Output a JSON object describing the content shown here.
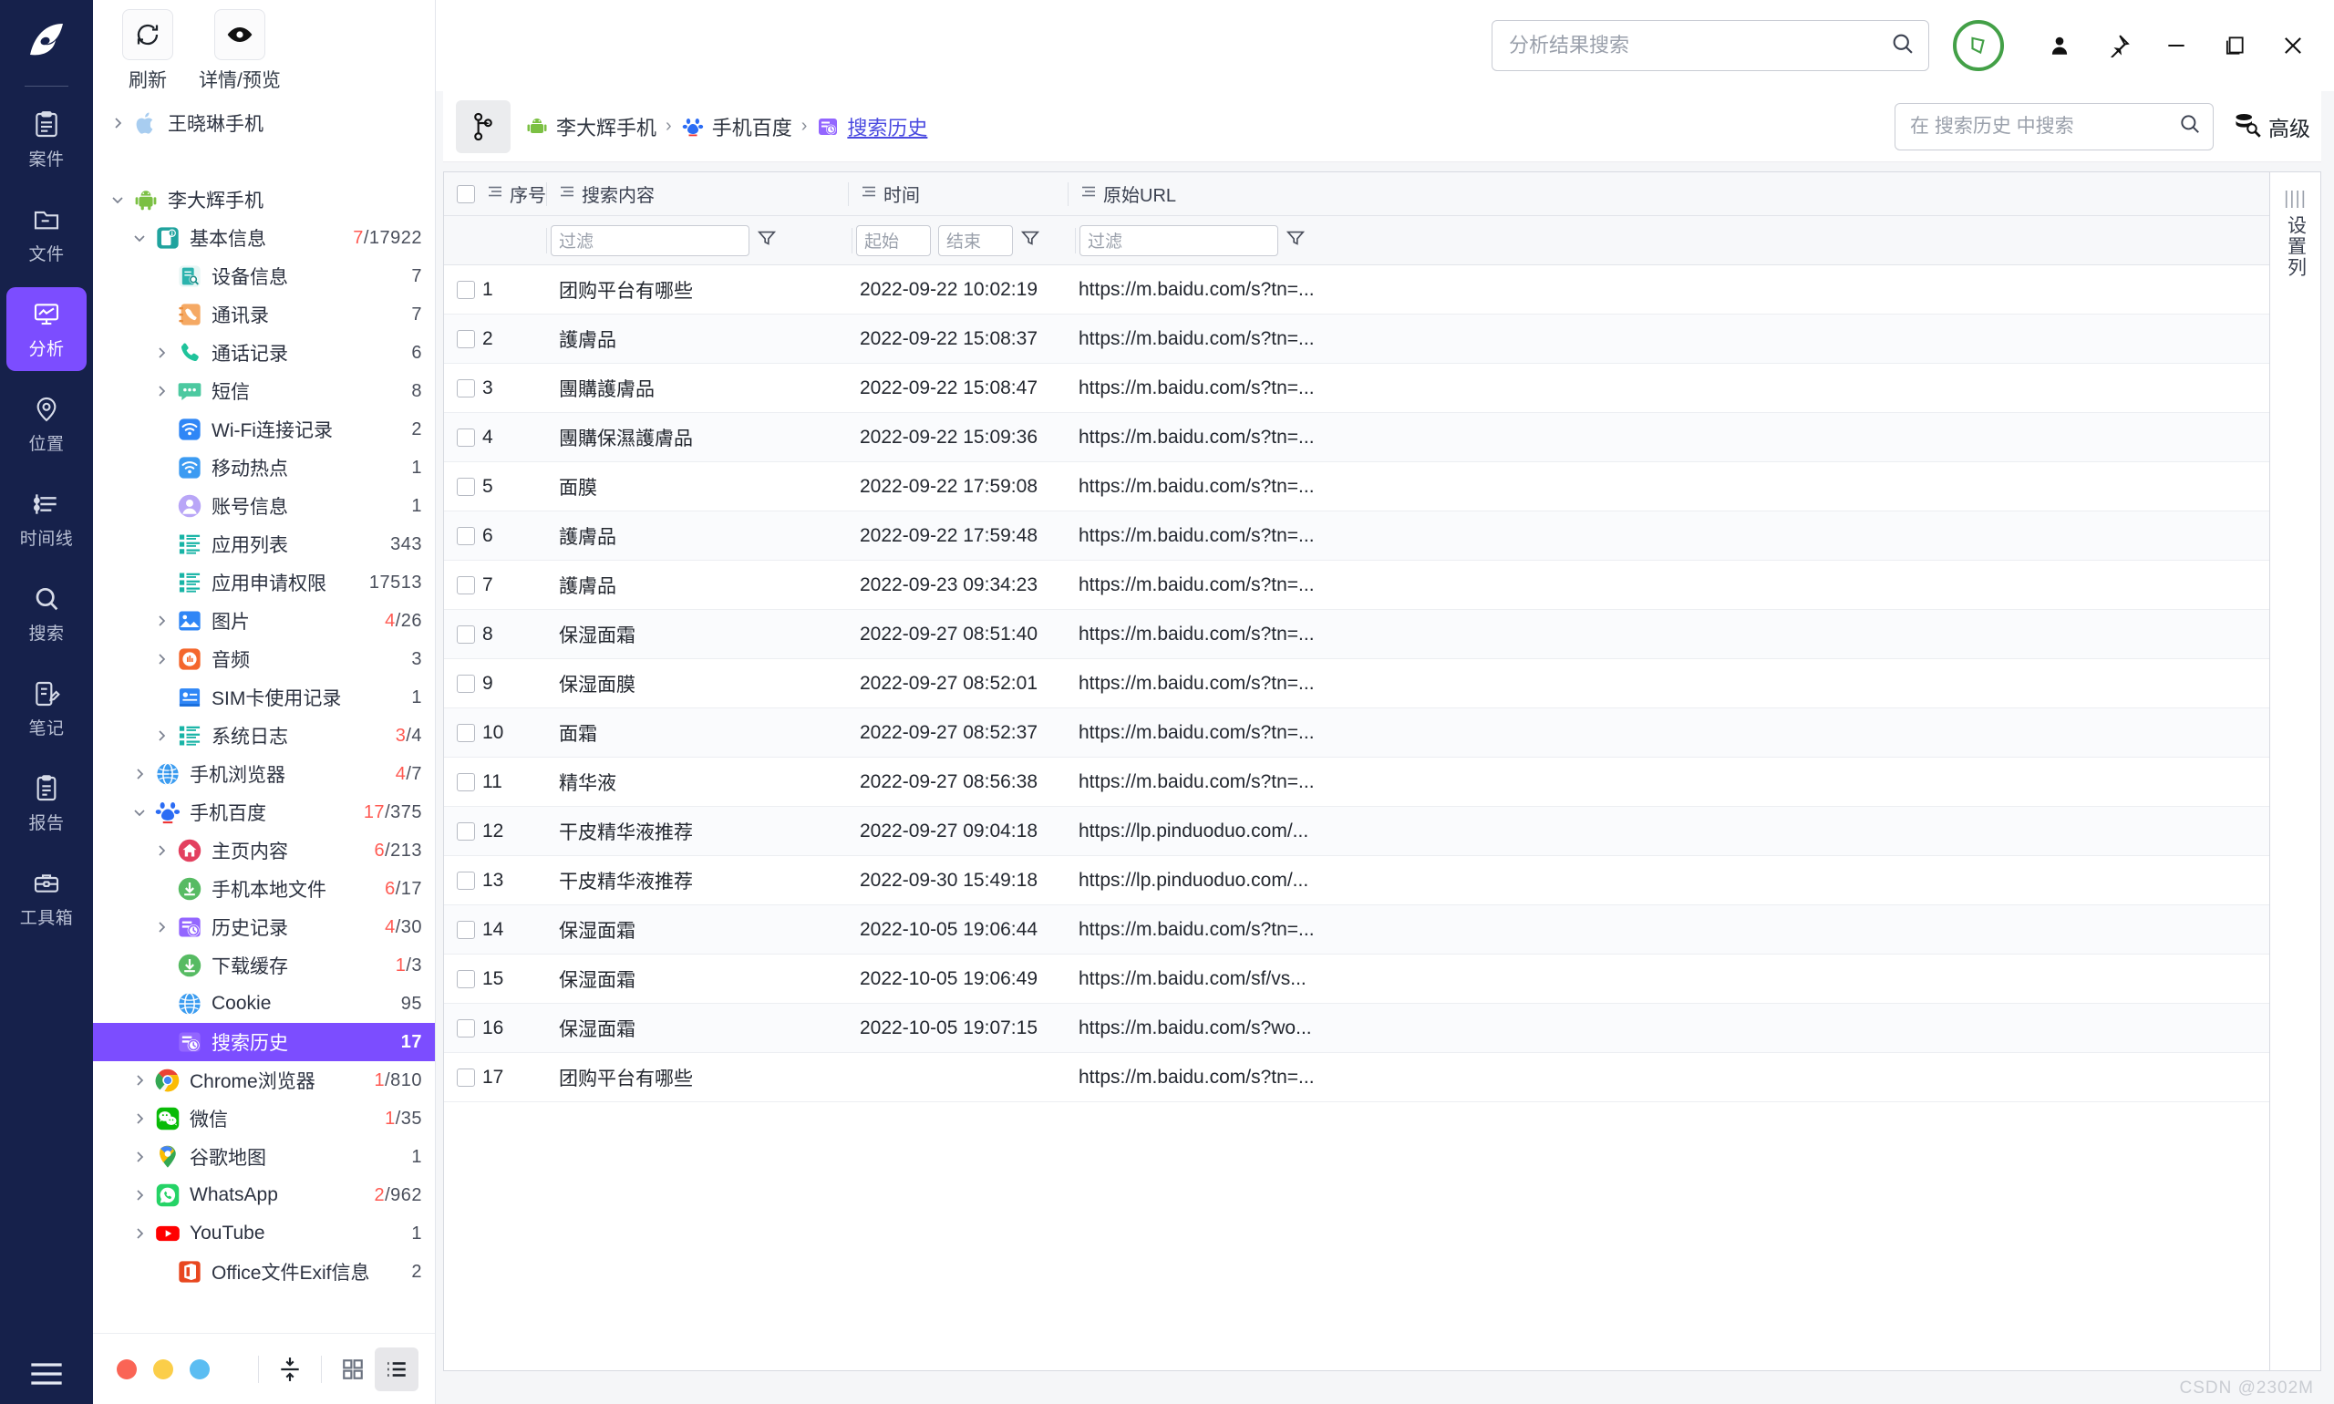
{
  "rail": {
    "logo_icon": "app-logo-icon",
    "items": [
      {
        "label": "案件",
        "icon": "case-icon",
        "active": false
      },
      {
        "label": "文件",
        "icon": "folder-icon",
        "active": false
      },
      {
        "label": "分析",
        "icon": "analysis-icon",
        "active": true
      },
      {
        "label": "位置",
        "icon": "location-icon",
        "active": false
      },
      {
        "label": "时间线",
        "icon": "timeline-icon",
        "active": false
      },
      {
        "label": "搜索",
        "icon": "search-icon",
        "active": false
      },
      {
        "label": "笔记",
        "icon": "notes-icon",
        "active": false
      },
      {
        "label": "报告",
        "icon": "report-icon",
        "active": false
      },
      {
        "label": "工具箱",
        "icon": "toolbox-icon",
        "active": false
      }
    ],
    "menu_icon": "hamburger-menu-icon"
  },
  "tree_toolbar": [
    {
      "label": "刷新",
      "icon": "refresh-icon"
    },
    {
      "label": "详情/预览",
      "icon": "eye-icon"
    }
  ],
  "tree": {
    "nodes": [
      {
        "label": "王晓琳手机",
        "icon": "apple-icon",
        "count": "",
        "count_red": "",
        "indent": 0,
        "caret": "right",
        "selected": false
      },
      {
        "label": "",
        "icon": "",
        "count": "",
        "count_red": "",
        "indent": 0,
        "caret": "",
        "selected": false,
        "spacer": true
      },
      {
        "label": "李大辉手机",
        "icon": "android-icon",
        "count": "",
        "count_red": "",
        "indent": 0,
        "caret": "down",
        "selected": false
      },
      {
        "label": "基本信息",
        "icon": "basicinfo-icon",
        "count": "/17922",
        "count_red": "7",
        "indent": 1,
        "caret": "down",
        "selected": false
      },
      {
        "label": "设备信息",
        "icon": "device-icon",
        "count": "7",
        "count_red": "",
        "indent": 2,
        "caret": "",
        "selected": false
      },
      {
        "label": "通讯录",
        "icon": "contacts-icon",
        "count": "7",
        "count_red": "",
        "indent": 2,
        "caret": "",
        "selected": false
      },
      {
        "label": "通话记录",
        "icon": "calllog-icon",
        "count": "6",
        "count_red": "",
        "indent": 2,
        "caret": "right",
        "selected": false
      },
      {
        "label": "短信",
        "icon": "sms-icon",
        "count": "8",
        "count_red": "",
        "indent": 2,
        "caret": "right",
        "selected": false
      },
      {
        "label": "Wi-Fi连接记录",
        "icon": "wifi-icon",
        "count": "2",
        "count_red": "",
        "indent": 2,
        "caret": "",
        "selected": false
      },
      {
        "label": "移动热点",
        "icon": "hotspot-icon",
        "count": "1",
        "count_red": "",
        "indent": 2,
        "caret": "",
        "selected": false
      },
      {
        "label": "账号信息",
        "icon": "account-icon",
        "count": "1",
        "count_red": "",
        "indent": 2,
        "caret": "",
        "selected": false
      },
      {
        "label": "应用列表",
        "icon": "applist-icon",
        "count": "343",
        "count_red": "",
        "indent": 2,
        "caret": "",
        "selected": false
      },
      {
        "label": "应用申请权限",
        "icon": "applist-icon",
        "count": "17513",
        "count_red": "",
        "indent": 2,
        "caret": "",
        "selected": false
      },
      {
        "label": "图片",
        "icon": "image-icon",
        "count": "/26",
        "count_red": "4",
        "indent": 2,
        "caret": "right",
        "selected": false
      },
      {
        "label": "音频",
        "icon": "audio-icon",
        "count": "3",
        "count_red": "",
        "indent": 2,
        "caret": "right",
        "selected": false
      },
      {
        "label": "SIM卡使用记录",
        "icon": "simcard-icon",
        "count": "1",
        "count_red": "",
        "indent": 2,
        "caret": "",
        "selected": false
      },
      {
        "label": "系统日志",
        "icon": "applist-icon",
        "count": "/4",
        "count_red": "3",
        "indent": 2,
        "caret": "right",
        "selected": false
      },
      {
        "label": "手机浏览器",
        "icon": "browser-icon",
        "count": "/7",
        "count_red": "4",
        "indent": 1,
        "caret": "right",
        "selected": false
      },
      {
        "label": "手机百度",
        "icon": "baidu-icon",
        "count": "/375",
        "count_red": "17",
        "indent": 1,
        "caret": "down",
        "selected": false
      },
      {
        "label": "主页内容",
        "icon": "home-icon",
        "count": "/213",
        "count_red": "6",
        "indent": 2,
        "caret": "right",
        "selected": false
      },
      {
        "label": "手机本地文件",
        "icon": "download-icon",
        "count": "/17",
        "count_red": "6",
        "indent": 2,
        "caret": "",
        "selected": false
      },
      {
        "label": "历史记录",
        "icon": "history-icon",
        "count": "/30",
        "count_red": "4",
        "indent": 2,
        "caret": "right",
        "selected": false
      },
      {
        "label": "下载缓存",
        "icon": "download-icon",
        "count": "/3",
        "count_red": "1",
        "indent": 2,
        "caret": "",
        "selected": false
      },
      {
        "label": "Cookie",
        "icon": "cookie-icon",
        "count": "95",
        "count_red": "",
        "indent": 2,
        "caret": "",
        "selected": false
      },
      {
        "label": "搜索历史",
        "icon": "history-icon",
        "count": "17",
        "count_red": "",
        "indent": 2,
        "caret": "",
        "selected": true
      },
      {
        "label": "Chrome浏览器",
        "icon": "chrome-icon",
        "count": "/810",
        "count_red": "1",
        "indent": 1,
        "caret": "right",
        "selected": false
      },
      {
        "label": "微信",
        "icon": "wechat-icon",
        "count": "/35",
        "count_red": "1",
        "indent": 1,
        "caret": "right",
        "selected": false
      },
      {
        "label": "谷歌地图",
        "icon": "gmaps-icon",
        "count": "1",
        "count_red": "",
        "indent": 1,
        "caret": "right",
        "selected": false
      },
      {
        "label": "WhatsApp",
        "icon": "whatsapp-icon",
        "count": "/962",
        "count_red": "2",
        "indent": 1,
        "caret": "right",
        "selected": false
      },
      {
        "label": "YouTube",
        "icon": "youtube-icon",
        "count": "1",
        "count_red": "",
        "indent": 1,
        "caret": "right",
        "selected": false
      },
      {
        "label": "Office文件Exif信息",
        "icon": "office-icon",
        "count": "2",
        "count_red": "",
        "indent": 2,
        "caret": "",
        "selected": false
      }
    ]
  },
  "tree_status": {
    "dots": [
      "#fa6455",
      "#fbce49",
      "#5bbdf2"
    ],
    "view_buttons": [
      {
        "icon": "collapse-icon",
        "active": false
      },
      {
        "icon": "grid-view-icon",
        "active": false
      },
      {
        "icon": "list-view-icon",
        "active": true
      }
    ]
  },
  "titlebar": {
    "search": {
      "value": "",
      "placeholder": "分析结果搜索",
      "icon": "search-icon"
    },
    "status_badge_icon": "shield-check-icon",
    "window_buttons": [
      {
        "icon": "user-icon"
      },
      {
        "icon": "pin-icon"
      },
      {
        "icon": "minimize-icon"
      },
      {
        "icon": "maximize-icon"
      },
      {
        "icon": "close-icon"
      }
    ]
  },
  "breadcrumb": {
    "branch_icon": "branch-icon",
    "items": [
      {
        "label": "李大辉手机",
        "icon": "android-icon",
        "link": false
      },
      {
        "label": "手机百度",
        "icon": "baidu-icon",
        "link": false
      },
      {
        "label": "搜索历史",
        "icon": "history-icon",
        "link": true
      }
    ],
    "separator": "›",
    "search": {
      "value": "",
      "placeholder": "在 搜索历史 中搜索",
      "icon": "search-icon"
    },
    "advanced": {
      "label": "高级",
      "icon": "advanced-search-icon"
    }
  },
  "table": {
    "columns": [
      {
        "key": "idx",
        "label": "序号"
      },
      {
        "key": "query",
        "label": "搜索内容"
      },
      {
        "key": "time",
        "label": "时间"
      },
      {
        "key": "url",
        "label": "原始URL"
      }
    ],
    "filters": {
      "query_placeholder": "过滤",
      "time_start_placeholder": "起始",
      "time_end_placeholder": "结束",
      "url_placeholder": "过滤",
      "filter_icon": "funnel-icon"
    },
    "rows": [
      {
        "idx": "1",
        "query": "团购平台有哪些",
        "time": "2022-09-22 10:02:19",
        "url": "https://m.baidu.com/s?tn=..."
      },
      {
        "idx": "2",
        "query": "護膚品",
        "time": "2022-09-22 15:08:37",
        "url": "https://m.baidu.com/s?tn=..."
      },
      {
        "idx": "3",
        "query": "團購護膚品",
        "time": "2022-09-22 15:08:47",
        "url": "https://m.baidu.com/s?tn=..."
      },
      {
        "idx": "4",
        "query": "團購保濕護膚品",
        "time": "2022-09-22 15:09:36",
        "url": "https://m.baidu.com/s?tn=..."
      },
      {
        "idx": "5",
        "query": "面膜",
        "time": "2022-09-22 17:59:08",
        "url": "https://m.baidu.com/s?tn=..."
      },
      {
        "idx": "6",
        "query": "護膚品",
        "time": "2022-09-22 17:59:48",
        "url": "https://m.baidu.com/s?tn=..."
      },
      {
        "idx": "7",
        "query": "護膚品",
        "time": "2022-09-23 09:34:23",
        "url": "https://m.baidu.com/s?tn=..."
      },
      {
        "idx": "8",
        "query": "保湿面霜",
        "time": "2022-09-27 08:51:40",
        "url": "https://m.baidu.com/s?tn=..."
      },
      {
        "idx": "9",
        "query": "保湿面膜",
        "time": "2022-09-27 08:52:01",
        "url": "https://m.baidu.com/s?tn=..."
      },
      {
        "idx": "10",
        "query": "面霜",
        "time": "2022-09-27 08:52:37",
        "url": "https://m.baidu.com/s?tn=..."
      },
      {
        "idx": "11",
        "query": "精华液",
        "time": "2022-09-27 08:56:38",
        "url": "https://m.baidu.com/s?tn=..."
      },
      {
        "idx": "12",
        "query": "干皮精华液推荐",
        "time": "2022-09-27 09:04:18",
        "url": "https://lp.pinduoduo.com/..."
      },
      {
        "idx": "13",
        "query": "干皮精华液推荐",
        "time": "2022-09-30 15:49:18",
        "url": "https://lp.pinduoduo.com/..."
      },
      {
        "idx": "14",
        "query": "保湿面霜",
        "time": "2022-10-05 19:06:44",
        "url": "https://m.baidu.com/s?tn=..."
      },
      {
        "idx": "15",
        "query": "保湿面霜",
        "time": "2022-10-05 19:06:49",
        "url": "https://m.baidu.com/sf/vs..."
      },
      {
        "idx": "16",
        "query": "保湿面霜",
        "time": "2022-10-05 19:07:15",
        "url": "https://m.baidu.com/s?wo..."
      },
      {
        "idx": "17",
        "query": "团购平台有哪些",
        "time": "",
        "url": "https://m.baidu.com/s?tn=..."
      }
    ]
  },
  "column_settings": {
    "grip": "||||",
    "label": "设置列"
  },
  "watermark": "CSDN @2302M"
}
